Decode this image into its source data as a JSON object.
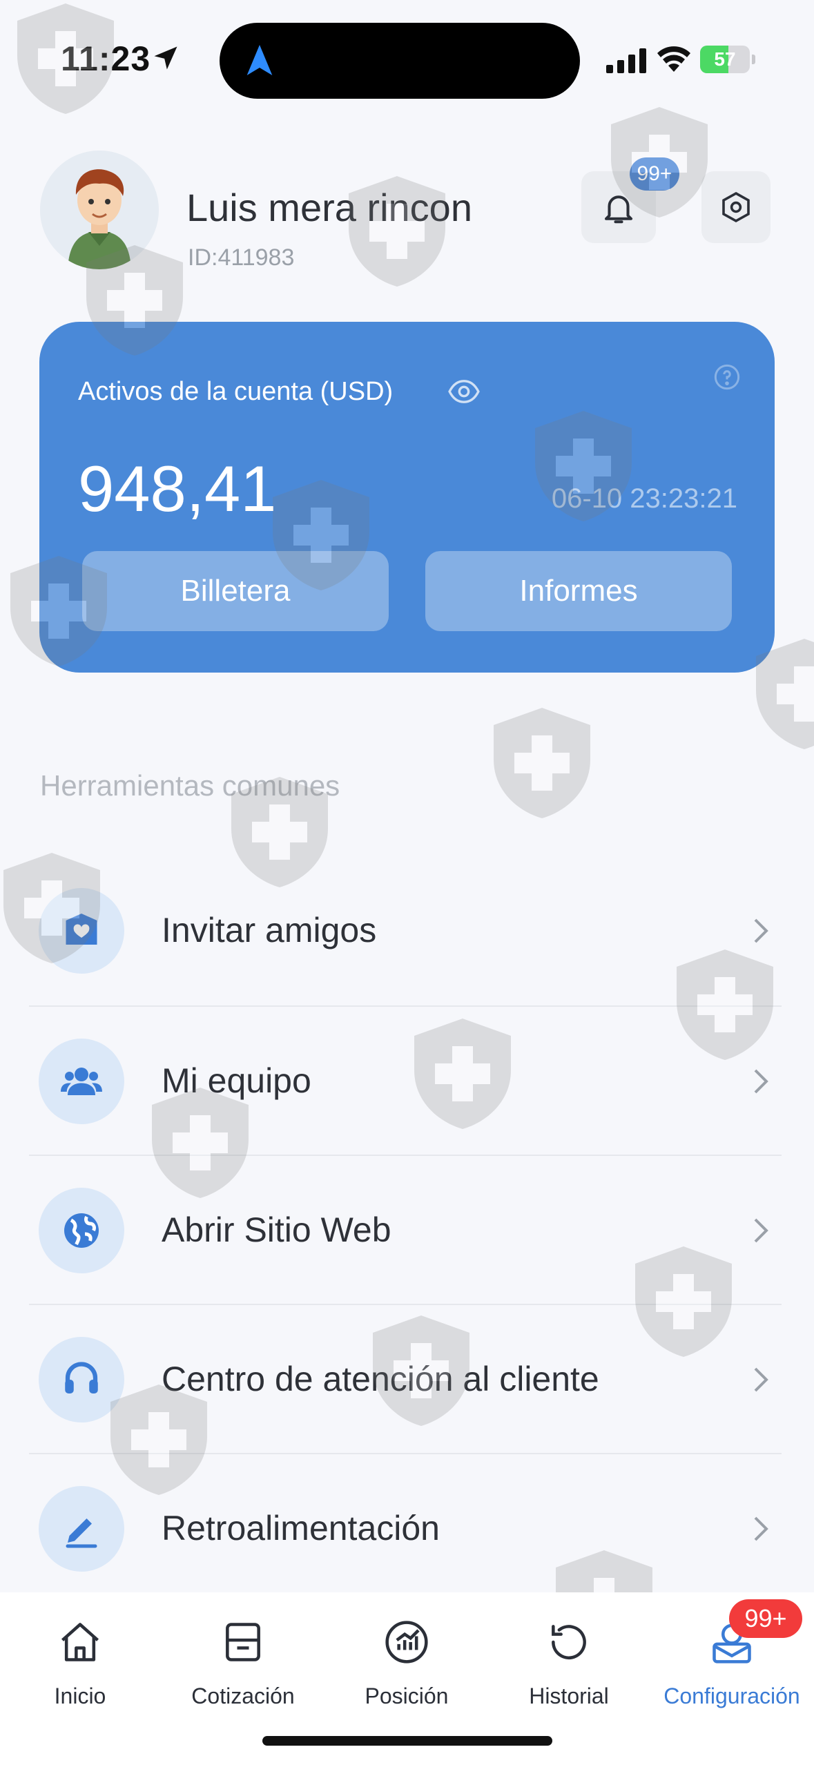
{
  "status_bar": {
    "time": "11:23",
    "battery_percent": "57",
    "battery_level": 0.57
  },
  "profile": {
    "name": "Luis mera rincon",
    "id": "ID:411983",
    "notification_badge": "99+"
  },
  "account": {
    "label": "Activos de la cuenta (USD)",
    "balance": "948,41",
    "timestamp": "06-10 23:23:21",
    "wallet_button": "Billetera",
    "reports_button": "Informes"
  },
  "tools": {
    "section_title": "Herramientas comunes",
    "items": [
      {
        "label": "Invitar amigos",
        "icon": "envelope-heart-icon"
      },
      {
        "label": "Mi equipo",
        "icon": "team-icon"
      },
      {
        "label": "Abrir Sitio Web",
        "icon": "globe-icon"
      },
      {
        "label": "Centro de atención al cliente",
        "icon": "headset-icon"
      },
      {
        "label": "Retroalimentación",
        "icon": "pencil-icon"
      }
    ]
  },
  "tab_bar": {
    "tabs": [
      {
        "label": "Inicio",
        "icon": "home-icon"
      },
      {
        "label": "Cotización",
        "icon": "inbox-tray-icon"
      },
      {
        "label": "Posición",
        "icon": "chart-circle-icon"
      },
      {
        "label": "Historial",
        "icon": "history-icon"
      },
      {
        "label": "Configuración",
        "icon": "profile-icon"
      }
    ],
    "active": "Configuración",
    "settings_badge": "99+"
  },
  "colors": {
    "accent": "#4a89d8",
    "tab_active": "#3a7bd5",
    "badge_red": "#f23b3b"
  }
}
